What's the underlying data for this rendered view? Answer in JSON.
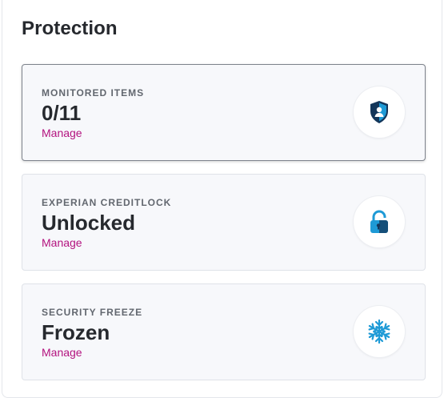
{
  "section_title": "Protection",
  "cards": [
    {
      "label": "MONITORED ITEMS",
      "value": "0/11",
      "link": "Manage",
      "icon": "shield-person-icon"
    },
    {
      "label": "EXPERIAN CREDITLOCK",
      "value": "Unlocked",
      "link": "Manage",
      "icon": "unlocked-padlock-icon"
    },
    {
      "label": "SECURITY FREEZE",
      "value": "Frozen",
      "link": "Manage",
      "icon": "snowflake-icon"
    }
  ],
  "colors": {
    "link": "#b3127f",
    "icon_blue": "#1e9ad6",
    "icon_navy": "#13365a",
    "card_bg": "#f7f8fb"
  }
}
